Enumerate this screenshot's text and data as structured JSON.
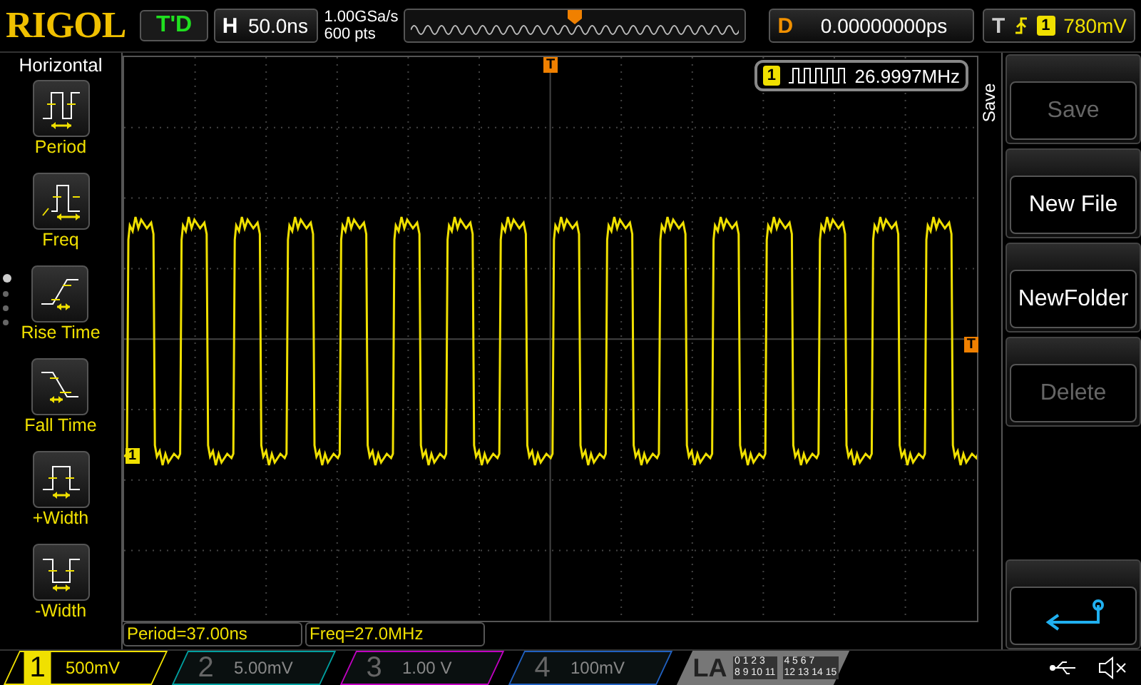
{
  "logo": "RIGOL",
  "run_status": "T'D",
  "timebase": {
    "label": "H",
    "value": "50.0ns"
  },
  "sampling": {
    "rate": "1.00GSa/s",
    "depth": "600 pts"
  },
  "delay": {
    "label": "D",
    "value": "0.00000000ps"
  },
  "trigger": {
    "label": "T",
    "source": "1",
    "level": "780mV"
  },
  "measure_panel": {
    "title": "Horizontal",
    "items": [
      {
        "kind": "period",
        "label": "Period"
      },
      {
        "kind": "freq",
        "label": "Freq"
      },
      {
        "kind": "rise",
        "label": "Rise Time"
      },
      {
        "kind": "fall",
        "label": "Fall Time"
      },
      {
        "kind": "pwidth",
        "label": "+Width"
      },
      {
        "kind": "nwidth",
        "label": "-Width"
      }
    ],
    "pages": [
      {
        "selected": true
      },
      {
        "selected": false
      },
      {
        "selected": false
      },
      {
        "selected": false
      }
    ]
  },
  "frequency_counter": {
    "channel": "1",
    "value": "26.9997MHz"
  },
  "markers": {
    "trigger_top": "T",
    "trigger_level": "T",
    "channel": "1"
  },
  "measurements": [
    "Period=37.00ns",
    "Freq=27.0MHz"
  ],
  "menu": {
    "title": "Save",
    "items": [
      {
        "kind": "text",
        "label": "Save",
        "disabled": true
      },
      {
        "kind": "text",
        "label": "New File",
        "disabled": false
      },
      {
        "kind": "text",
        "label": "NewFolder",
        "disabled": false
      },
      {
        "kind": "text",
        "label": "Delete",
        "disabled": true
      },
      {
        "kind": "gap"
      },
      {
        "kind": "back",
        "disabled": false
      }
    ]
  },
  "channels": [
    {
      "number": "1",
      "scale": "500mV",
      "selected": true,
      "color": "#f0e000"
    },
    {
      "number": "2",
      "scale": "5.00mV",
      "selected": false,
      "color": "#00a0a0"
    },
    {
      "number": "3",
      "scale": "1.00 V",
      "selected": false,
      "color": "#c000c0"
    },
    {
      "number": "4",
      "scale": "100mV",
      "selected": false,
      "color": "#2060c0"
    }
  ],
  "logic_analyzer": {
    "label": "LA",
    "groups": [
      [
        "0",
        "1",
        "2",
        "3"
      ],
      [
        "4",
        "5",
        "6",
        "7"
      ],
      [
        "8",
        "9",
        "10",
        "11"
      ],
      [
        "12",
        "13",
        "14",
        "15"
      ]
    ]
  }
}
